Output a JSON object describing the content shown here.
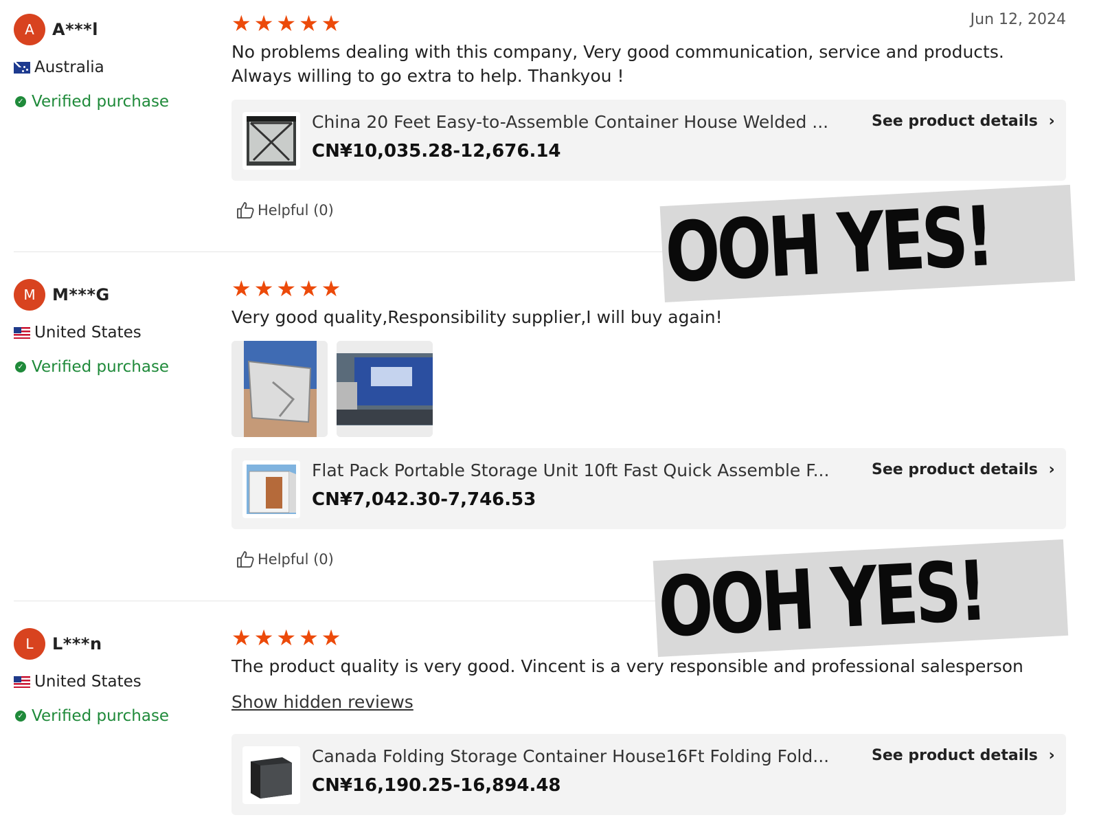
{
  "reviews": [
    {
      "avatar_letter": "A",
      "username": "A***l",
      "country": "Australia",
      "flag_icon": "australia-flag-icon",
      "verified": "Verified purchase",
      "rating": 5,
      "date": "Jun 12, 2024",
      "text": "No problems dealing with this company, Very good communication, service and products. Always willing to go extra to help. Thankyou !",
      "product": {
        "title": "China 20 Feet Easy-to-Assemble Container House Welded ...",
        "price": "CN¥10,035.28-12,676.14",
        "details_label": "See product details"
      },
      "helpful": "Helpful (0)"
    },
    {
      "avatar_letter": "M",
      "username": "M***G",
      "country": "United States",
      "flag_icon": "united-states-flag-icon",
      "verified": "Verified purchase",
      "rating": 5,
      "text": "Very good quality,Responsibility supplier,I will buy again!",
      "photos": [
        "container-photo",
        "truck-photo"
      ],
      "product": {
        "title": "Flat Pack Portable Storage Unit 10ft Fast Quick Assemble F...",
        "price": "CN¥7,042.30-7,746.53",
        "details_label": "See product details"
      },
      "helpful": "Helpful (0)"
    },
    {
      "avatar_letter": "L",
      "username": "L***n",
      "country": "United States",
      "flag_icon": "united-states-flag-icon",
      "verified": "Verified purchase",
      "rating": 5,
      "text": "The product quality is very good. Vincent is a very responsible and professional salesperson",
      "show_hidden": "Show hidden reviews",
      "product": {
        "title": "Canada Folding Storage Container House16Ft Folding Fold...",
        "price": "CN¥16,190.25-16,894.48",
        "details_label": "See product details"
      }
    }
  ],
  "stickers": [
    "OOH YES!",
    "OOH YES!"
  ],
  "colors": {
    "accent_star": "#ec4a0a",
    "avatar": "#d8431f",
    "verified": "#1f8a3a",
    "card_bg": "#f3f3f3",
    "sticker_bg": "#d9d9d9"
  }
}
